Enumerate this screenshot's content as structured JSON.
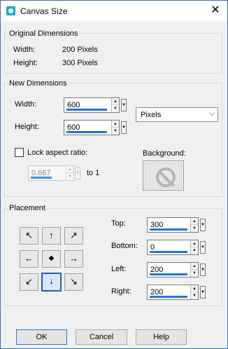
{
  "window": {
    "title": "Canvas Size",
    "close_glyph": "✕"
  },
  "original": {
    "title": "Original Dimensions",
    "width_label": "Width:",
    "width_value": "200 Pixels",
    "height_label": "Height:",
    "height_value": "300 Pixels"
  },
  "new_dims": {
    "title": "New Dimensions",
    "width_label": "Width:",
    "width_value": "600",
    "height_label": "Height:",
    "height_value": "600",
    "units": "Pixels",
    "lock_label": "Lock aspect ratio:",
    "lock_checked": false,
    "ratio_value": "0.667",
    "ratio_suffix": "to 1",
    "background_label": "Background:"
  },
  "placement": {
    "title": "Placement",
    "grid": [
      "↖",
      "↑",
      "↗",
      "←",
      "◆",
      "→",
      "↙",
      "↓",
      "↘"
    ],
    "selected_index": 7,
    "top_label": "Top:",
    "top_value": "300",
    "bottom_label": "Bottom:",
    "bottom_value": "0",
    "left_label": "Left:",
    "left_value": "200",
    "right_label": "Right:",
    "right_value": "200"
  },
  "buttons": {
    "ok": "OK",
    "cancel": "Cancel",
    "help": "Help"
  },
  "colors": {
    "accent": "#1e78d8",
    "dialog_bg": "#f0f0f0",
    "app_icon": "#1aa7d8"
  },
  "icons": {
    "app": "canvas-app-icon",
    "close": "close-icon",
    "background": "no-symbol-icon",
    "spin_up": "▲",
    "spin_down": "▼",
    "dropdown": "chevron-down-icon"
  }
}
